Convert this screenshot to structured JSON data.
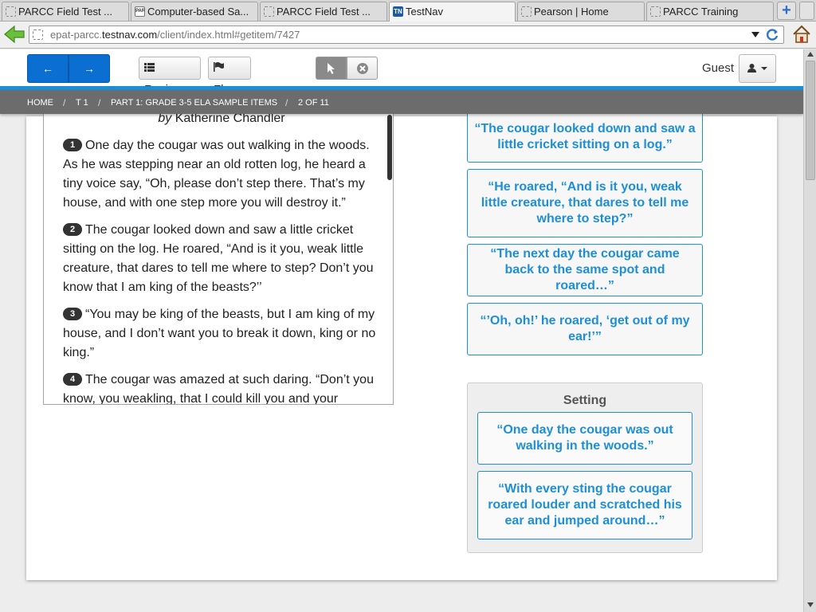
{
  "browser": {
    "tabs": [
      {
        "label": "PARCC Field Test ...",
        "favicon": "page-icon"
      },
      {
        "label": "Computer-based Sa...",
        "favicon": "parcc-icon",
        "favicon_text": "PARCC"
      },
      {
        "label": "PARCC Field Test ...",
        "favicon": "page-icon"
      },
      {
        "label": "TestNav",
        "favicon": "testnav-icon",
        "favicon_text": "TN",
        "active": true
      },
      {
        "label": "Pearson | Home",
        "favicon": "page-icon"
      },
      {
        "label": "PARCC Training",
        "favicon": "page-icon"
      }
    ],
    "url_prefix": "epat-parcc.",
    "url_domain": "testnav.com",
    "url_suffix": "/client/index.html#getitem/7427"
  },
  "toolbar": {
    "prev_icon": "←",
    "next_icon": "→",
    "review_label": "Review",
    "flag_label": "Flag",
    "guest_label": "Guest"
  },
  "breadcrumb": {
    "home": "HOME",
    "test": "T 1",
    "part": "PART 1: GRADE 3-5 ELA SAMPLE ITEMS",
    "position": "2 OF 11"
  },
  "passage": {
    "byline_prefix": "by",
    "byline_author": "Katherine Chandler",
    "paragraphs": [
      {
        "num": "1",
        "text": "One day the cougar was out walking in the woods. As he was stepping near an old rotten log, he heard a tiny voice say, “Oh, please don’t step there. That’s my house, and with one step more you will destroy it.”"
      },
      {
        "num": "2",
        "text": "The cougar looked down and saw a little cricket sitting on the log. He roared, “And is it you, weak little creature, that dares to tell me where to step? Don’t you know that I am king of the beasts?’’"
      },
      {
        "num": "3",
        "text": "“You may be king of the beasts, but I am king of my house, and I don’t want you to break it down, king or no king.”"
      },
      {
        "num": "4",
        "text": "The cougar was amazed at such daring. “Don’t you know, you weakling, that I could kill you and your"
      }
    ]
  },
  "answers": [
    "“The cougar looked down and saw a little cricket sitting on a log.”",
    "“He roared, “And is it you, weak little creature, that dares to tell me where to step?”",
    "“The next day the cougar came back to the same spot and roared…”",
    "“’Oh, oh!’ he roared, ‘get out of my ear!’”"
  ],
  "setting": {
    "title": "Setting",
    "items": [
      "“One day the cougar was out walking in the woods.”",
      "“With every sting the cougar roared louder and scratched his ear and jumped around…”"
    ]
  },
  "colors": {
    "accent": "#1e8fd6",
    "nav_button": "#0a6fd0",
    "breadcrumb_bar": "#6c6c6c"
  }
}
